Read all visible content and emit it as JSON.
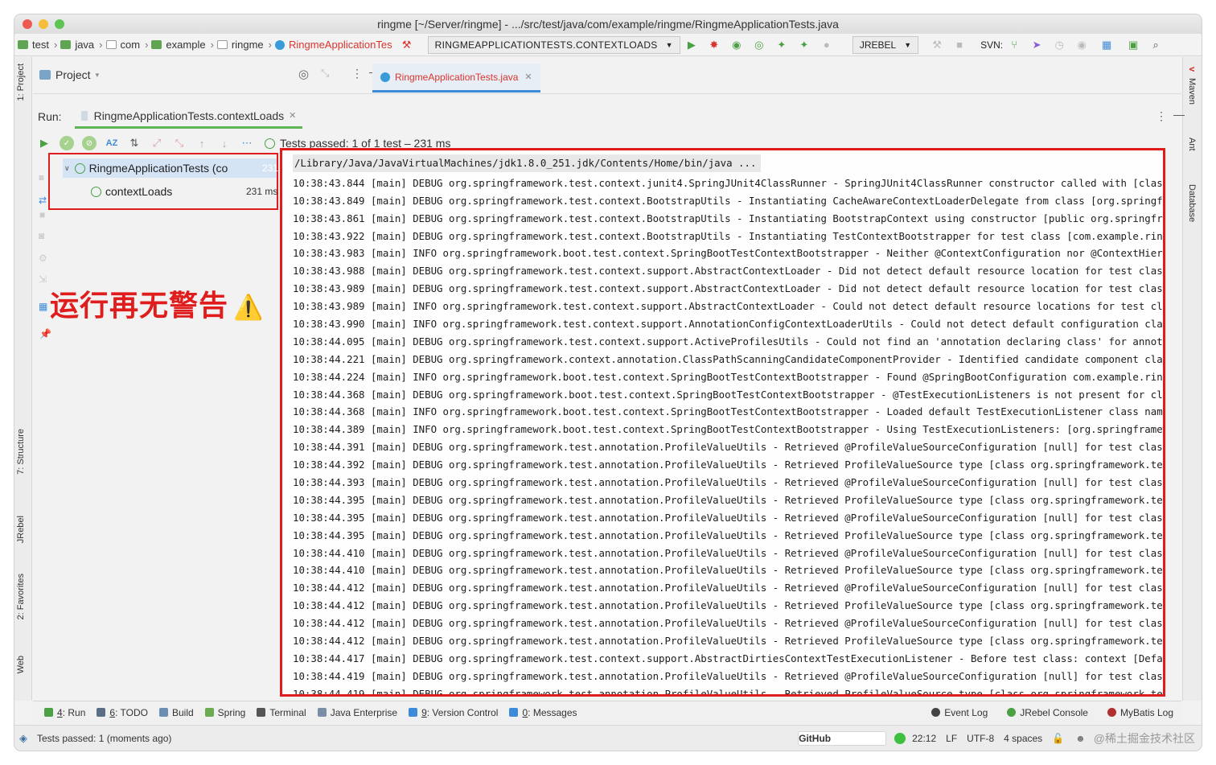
{
  "window": {
    "title": "ringme [~/Server/ringme] - .../src/test/java/com/example/ringme/RingmeApplicationTests.java"
  },
  "navbar": {
    "breadcrumbs": [
      "test",
      "java",
      "com",
      "example",
      "ringme",
      "RingmeApplicationTes"
    ],
    "run_config": "RINGMEAPPLICATIONTESTS.CONTEXTLOADS",
    "jrebel": "JREBEL",
    "svn": "SVN:"
  },
  "left_stripe": {
    "project": "1: Project",
    "structure": "7: Structure",
    "jrebel": "JRebel",
    "favorites": "2: Favorites",
    "web": "Web"
  },
  "right_stripe": {
    "maven": "Maven",
    "ant": "Ant",
    "database": "Database"
  },
  "project_panel": {
    "label": "Project"
  },
  "editor": {
    "tab": "RingmeApplicationTests.java"
  },
  "run": {
    "label": "Run:",
    "tab": "RingmeApplicationTests.contextLoads",
    "status": "Tests passed: 1 of 1 test – 231 ms",
    "tree": [
      {
        "name": "RingmeApplicationTests (co",
        "time": "231 ms"
      },
      {
        "name": "contextLoads",
        "time": "231 ms"
      }
    ]
  },
  "annotation": {
    "text": "运行再无警告",
    "sign": "⚠️"
  },
  "console": {
    "lines": [
      "/Library/Java/JavaVirtualMachines/jdk1.8.0_251.jdk/Contents/Home/bin/java ...",
      "10:38:43.844 [main] DEBUG org.springframework.test.context.junit4.SpringJUnit4ClassRunner - SpringJUnit4ClassRunner constructor called with [class c",
      "10:38:43.849 [main] DEBUG org.springframework.test.context.BootstrapUtils - Instantiating CacheAwareContextLoaderDelegate from class [org.springfram",
      "10:38:43.861 [main] DEBUG org.springframework.test.context.BootstrapUtils - Instantiating BootstrapContext using constructor [public org.springframe",
      "10:38:43.922 [main] DEBUG org.springframework.test.context.BootstrapUtils - Instantiating TestContextBootstrapper for test class [com.example.ringme",
      "10:38:43.983 [main] INFO org.springframework.boot.test.context.SpringBootTestContextBootstrapper - Neither @ContextConfiguration nor @ContextHierarc",
      "10:38:43.988 [main] DEBUG org.springframework.test.context.support.AbstractContextLoader - Did not detect default resource location for test class |",
      "10:38:43.989 [main] DEBUG org.springframework.test.context.support.AbstractContextLoader - Did not detect default resource location for test class |",
      "10:38:43.989 [main] INFO org.springframework.test.context.support.AbstractContextLoader - Could not detect default resource locations for test class",
      "10:38:43.990 [main] INFO org.springframework.test.context.support.AnnotationConfigContextLoaderUtils - Could not detect default configuration classe",
      "10:38:44.095 [main] DEBUG org.springframework.test.context.support.ActiveProfilesUtils - Could not find an 'annotation declaring class' for annotati",
      "10:38:44.221 [main] DEBUG org.springframework.context.annotation.ClassPathScanningCandidateComponentProvider - Identified candidate component class:",
      "10:38:44.224 [main] INFO org.springframework.boot.test.context.SpringBootTestContextBootstrapper - Found @SpringBootConfiguration com.example.ringme",
      "10:38:44.368 [main] DEBUG org.springframework.boot.test.context.SpringBootTestContextBootstrapper - @TestExecutionListeners is not present for class",
      "10:38:44.368 [main] INFO org.springframework.boot.test.context.SpringBootTestContextBootstrapper - Loaded default TestExecutionListener class names",
      "10:38:44.389 [main] INFO org.springframework.boot.test.context.SpringBootTestContextBootstrapper - Using TestExecutionListeners: [org.springframewor",
      "10:38:44.391 [main] DEBUG org.springframework.test.annotation.ProfileValueUtils - Retrieved @ProfileValueSourceConfiguration [null] for test class |",
      "10:38:44.392 [main] DEBUG org.springframework.test.annotation.ProfileValueUtils - Retrieved ProfileValueSource type [class org.springframework.test.",
      "10:38:44.393 [main] DEBUG org.springframework.test.annotation.ProfileValueUtils - Retrieved @ProfileValueSourceConfiguration [null] for test class |",
      "10:38:44.395 [main] DEBUG org.springframework.test.annotation.ProfileValueUtils - Retrieved ProfileValueSource type [class org.springframework.test.",
      "10:38:44.395 [main] DEBUG org.springframework.test.annotation.ProfileValueUtils - Retrieved @ProfileValueSourceConfiguration [null] for test class |",
      "10:38:44.395 [main] DEBUG org.springframework.test.annotation.ProfileValueUtils - Retrieved ProfileValueSource type [class org.springframework.test.",
      "10:38:44.410 [main] DEBUG org.springframework.test.annotation.ProfileValueUtils - Retrieved @ProfileValueSourceConfiguration [null] for test class |",
      "10:38:44.410 [main] DEBUG org.springframework.test.annotation.ProfileValueUtils - Retrieved ProfileValueSource type [class org.springframework.test.",
      "10:38:44.412 [main] DEBUG org.springframework.test.annotation.ProfileValueUtils - Retrieved @ProfileValueSourceConfiguration [null] for test class |",
      "10:38:44.412 [main] DEBUG org.springframework.test.annotation.ProfileValueUtils - Retrieved ProfileValueSource type [class org.springframework.test.",
      "10:38:44.412 [main] DEBUG org.springframework.test.annotation.ProfileValueUtils - Retrieved @ProfileValueSourceConfiguration [null] for test class |",
      "10:38:44.412 [main] DEBUG org.springframework.test.annotation.ProfileValueUtils - Retrieved ProfileValueSource type [class org.springframework.test.",
      "10:38:44.417 [main] DEBUG org.springframework.test.context.support.AbstractDirtiesContextTestExecutionListener - Before test class: context [Default",
      "10:38:44.419 [main] DEBUG org.springframework.test.annotation.ProfileValueUtils - Retrieved @ProfileValueSourceConfiguration [null] for test class |",
      "10:38:44.419 [main] DEBUG org.springframework.test.annotation.ProfileValueUtils - Retrieved ProfileValueSource type [class org.springframework.test."
    ]
  },
  "bottom_tools": [
    {
      "num": "4",
      "label": ": Run",
      "icon": "run-icon",
      "color": "#4aa043"
    },
    {
      "num": "6",
      "label": ": TODO",
      "icon": "todo-icon",
      "color": "#5a6e84"
    },
    {
      "num": "",
      "label": "Build",
      "icon": "build-icon",
      "color": "#6b8fb3"
    },
    {
      "num": "",
      "label": "Spring",
      "icon": "spring-icon",
      "color": "#6aab4f"
    },
    {
      "num": "",
      "label": "Terminal",
      "icon": "terminal-icon",
      "color": "#555555"
    },
    {
      "num": "",
      "label": "Java Enterprise",
      "icon": "java-enterprise-icon",
      "color": "#7a8ea6"
    },
    {
      "num": "9",
      "label": ": Version Control",
      "icon": "version-control-icon",
      "color": "#3d8bd8"
    },
    {
      "num": "0",
      "label": ": Messages",
      "icon": "messages-icon",
      "color": "#3d8bd8"
    }
  ],
  "bottom_tools_right": [
    {
      "label": "Event Log",
      "icon": "event-log-icon"
    },
    {
      "label": "JRebel Console",
      "icon": "jrebel-console-icon"
    },
    {
      "label": "MyBatis Log",
      "icon": "mybatis-log-icon"
    }
  ],
  "status": {
    "message": "Tests passed: 1 (moments ago)",
    "github": "GitHub",
    "position": "22:12",
    "line_sep": "LF",
    "encoding": "UTF-8",
    "indent": "4 spaces",
    "watermark": "@稀土掘金技术社区"
  },
  "colors": {
    "accent_red": "#e01d1d",
    "pass_green": "#4aa043",
    "tab_blue": "#3d8bd8"
  }
}
